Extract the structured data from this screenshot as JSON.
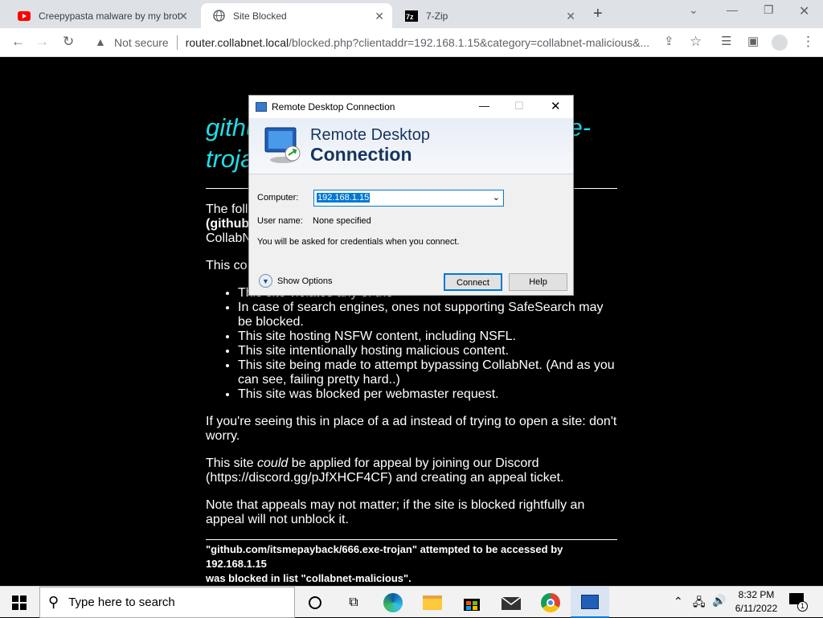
{
  "browser": {
    "tabs": [
      {
        "title": "Creepypasta malware by my brot",
        "active": false
      },
      {
        "title": "Site Blocked",
        "active": true
      },
      {
        "title": "7-Zip",
        "active": false
      }
    ],
    "security_label": "Not secure",
    "url_host": "router.collabnet.local",
    "url_rest": "/blocked.php?clientaddr=192.168.1.15&category=collabnet-malicious&..."
  },
  "page": {
    "heading": "github.com/itsmepayback/666.exe-trojan",
    "intro_line1": "The foll",
    "intro_line2": "(github",
    "intro_line3": "CollabN",
    "reasons_intro": "This co",
    "reasons": [
      "This site violates any of the",
      "In case of search engines, ones not supporting SafeSearch may be blocked.",
      "This site hosting NSFW content, including NSFL.",
      "This site intentionally hosting malicious content.",
      "This site being made to attempt bypassing CollabNet. (And as you can see, failing pretty hard..)",
      "This site was blocked per webmaster request."
    ],
    "para_ad": "If you're seeing this in place of a ad instead of trying to open a site: don't worry.",
    "para_appeal_pre": "This site ",
    "para_appeal_em": "could",
    "para_appeal_post": " be applied for appeal by joining our Discord (https://discord.gg/pJfXHCF4CF) and creating an appeal ticket.",
    "para_note": "Note that appeals may not matter; if the site is blocked rightfully an appeal will not unblock it.",
    "footer_pre": "\"github.com/itsmepayback/666.exe-trojan\" attempted to be accessed by ",
    "footer_ip": "192.168.1.15",
    "footer_post": "was blocked in list \"collabnet-malicious\"."
  },
  "rdp": {
    "window_title": "Remote Desktop Connection",
    "banner_line1": "Remote Desktop",
    "banner_line2": "Connection",
    "computer_label": "Computer:",
    "computer_value": "192.168.1.15",
    "username_label": "User name:",
    "username_value": "None specified",
    "credentials_note": "You will be asked for credentials when you connect.",
    "show_options": "Show Options",
    "connect": "Connect",
    "help": "Help"
  },
  "taskbar": {
    "search_placeholder": "Type here to search",
    "time": "8:32 PM",
    "date": "6/11/2022",
    "notification_count": "1"
  },
  "colors": {
    "heading": "#1ee0e8",
    "accent": "#0078d7"
  }
}
